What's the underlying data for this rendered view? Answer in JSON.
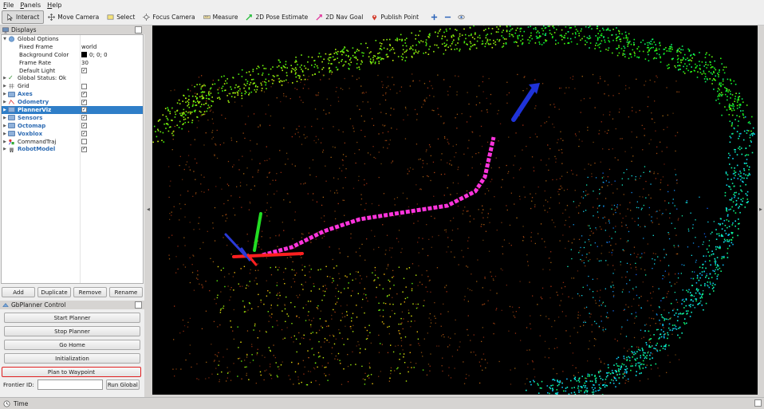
{
  "menu": [
    {
      "u": "F",
      "rest": "ile"
    },
    {
      "u": "P",
      "rest": "anels"
    },
    {
      "u": "H",
      "rest": "elp"
    }
  ],
  "toolbar": {
    "interact": "Interact",
    "move_camera": "Move Camera",
    "select": "Select",
    "focus_camera": "Focus Camera",
    "measure": "Measure",
    "pose_estimate": "2D Pose Estimate",
    "nav_goal": "2D Nav Goal",
    "publish_point": "Publish Point"
  },
  "displays": {
    "title": "Displays",
    "global_options": "Global Options",
    "fixed_frame_label": "Fixed Frame",
    "fixed_frame_value": "world",
    "bg_color_label": "Background Color",
    "bg_color_value": "0; 0; 0",
    "frame_rate_label": "Frame Rate",
    "frame_rate_value": "30",
    "default_light_label": "Default Light",
    "global_status": "Global Status: Ok",
    "items": [
      {
        "label": "Grid",
        "checked": false,
        "bold": false
      },
      {
        "label": "Axes",
        "checked": true,
        "bold": true
      },
      {
        "label": "Odometry",
        "checked": true,
        "bold": true
      },
      {
        "label": "PlannerViz",
        "checked": true,
        "bold": true
      },
      {
        "label": "Sensors",
        "checked": true,
        "bold": true
      },
      {
        "label": "Octomap",
        "checked": true,
        "bold": true
      },
      {
        "label": "Voxblox",
        "checked": true,
        "bold": true
      },
      {
        "label": "CommandTraj",
        "checked": false,
        "bold": false
      },
      {
        "label": "RobotModel",
        "checked": true,
        "bold": true
      }
    ],
    "buttons": {
      "add": "Add",
      "duplicate": "Duplicate",
      "remove": "Remove",
      "rename": "Rename"
    }
  },
  "gb": {
    "title": "GbPlanner Control",
    "start": "Start Planner",
    "stop": "Stop Planner",
    "home": "Go Home",
    "init": "Initialization",
    "waypoint": "Plan to Waypoint",
    "frontier_label": "Frontier ID:",
    "frontier_value": "",
    "run_global": "Run Global"
  },
  "time": {
    "title": "Time"
  },
  "colors": {
    "selection": "#2f7ec8",
    "highlight_border": "#e02020",
    "path": "#ff33dd"
  }
}
